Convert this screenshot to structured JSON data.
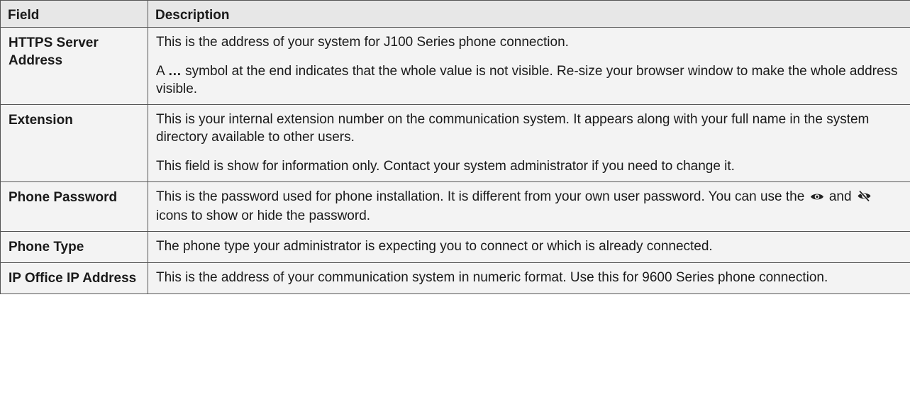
{
  "table": {
    "headers": {
      "field": "Field",
      "description": "Description"
    },
    "rows": [
      {
        "field": "HTTPS Server Address",
        "paragraphs": [
          "This is the address of your system for J100 Series phone connection."
        ],
        "ellipsis_note": {
          "prefix": "A ",
          "symbol": "…",
          "suffix": " symbol at the end indicates that the whole value is not visible. Re-size your browser window to make the whole address visible."
        }
      },
      {
        "field": "Extension",
        "paragraphs": [
          "This is your internal extension number on the communication system. It appears along with your full name in the system directory available to other users.",
          "This field is show for information only. Contact your system administrator if you need to change it."
        ]
      },
      {
        "field": "Phone Password",
        "password_text": {
          "before": "This is the password used for phone installation. It is different from your own user password. You can use the ",
          "show_icon": "eye-icon",
          "middle": " and ",
          "hide_icon": "eye-slash-icon",
          "after": " icons to show or hide the password."
        }
      },
      {
        "field": "Phone Type",
        "paragraphs": [
          "The phone type your administrator is expecting you to connect or which is already connected."
        ]
      },
      {
        "field": "IP Office IP Address",
        "paragraphs": [
          "This is the address of your communication system in numeric format. Use this for 9600 Series phone connection."
        ]
      }
    ]
  },
  "colors": {
    "header_bg": "#e7e7e7",
    "cell_bg": "#f3f3f3",
    "border": "#555555",
    "text": "#1a1a1a"
  }
}
